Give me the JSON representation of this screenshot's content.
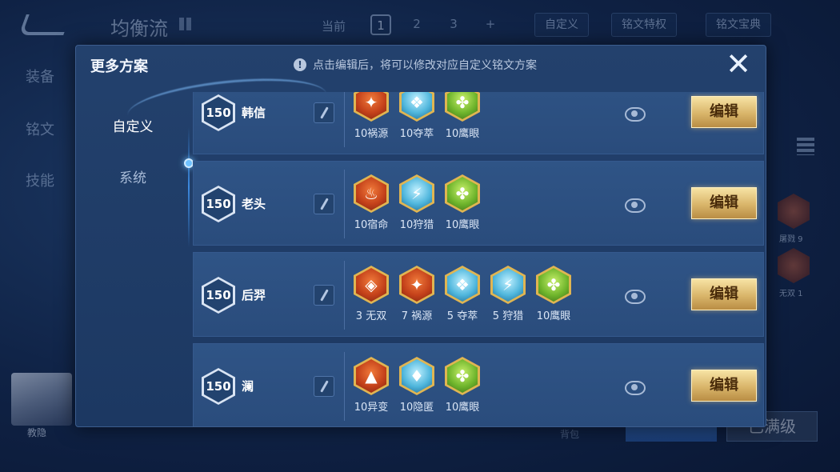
{
  "background": {
    "title": "均衡流",
    "current_label": "当前",
    "pages": [
      "1",
      "2",
      "3",
      "+"
    ],
    "buttons": [
      "自定义",
      "铭文特权",
      "铭文宝典"
    ],
    "side_items": [
      "装备",
      "铭文",
      "技能"
    ],
    "hero_name": "教隐",
    "right_runes": [
      "屠戮 9",
      "无双 1"
    ],
    "level_button": "已满级",
    "bottom_small": "背包"
  },
  "modal": {
    "title": "更多方案",
    "notice": "点击编辑后，将可以修改对应自定义铭文方案",
    "notice_icon": "!",
    "close_label": "✕",
    "tabs": [
      "自定义",
      "系统"
    ],
    "edit_label": "编辑",
    "schemes": [
      {
        "level": "150",
        "hero": "韩信",
        "runes": [
          {
            "label": "10祸源",
            "color": "red",
            "icon": "✦"
          },
          {
            "label": "10夺萃",
            "color": "blue",
            "icon": "❖"
          },
          {
            "label": "10鹰眼",
            "color": "green",
            "icon": "✤"
          }
        ]
      },
      {
        "level": "150",
        "hero": "老头",
        "runes": [
          {
            "label": "10宿命",
            "color": "red",
            "icon": "♨"
          },
          {
            "label": "10狩猎",
            "color": "blue",
            "icon": "⚡"
          },
          {
            "label": "10鹰眼",
            "color": "green",
            "icon": "✤"
          }
        ]
      },
      {
        "level": "150",
        "hero": "后羿",
        "runes": [
          {
            "label": "3 无双",
            "color": "red",
            "icon": "◈"
          },
          {
            "label": "7 祸源",
            "color": "red",
            "icon": "✦"
          },
          {
            "label": "5 夺萃",
            "color": "blue",
            "icon": "❖"
          },
          {
            "label": "5 狩猎",
            "color": "blue",
            "icon": "⚡"
          },
          {
            "label": "10鹰眼",
            "color": "green",
            "icon": "✤"
          }
        ]
      },
      {
        "level": "150",
        "hero": "澜",
        "runes": [
          {
            "label": "10异变",
            "color": "red",
            "icon": "▲"
          },
          {
            "label": "10隐匿",
            "color": "blue",
            "icon": "♦"
          },
          {
            "label": "10鹰眼",
            "color": "green",
            "icon": "✤"
          }
        ]
      }
    ]
  }
}
